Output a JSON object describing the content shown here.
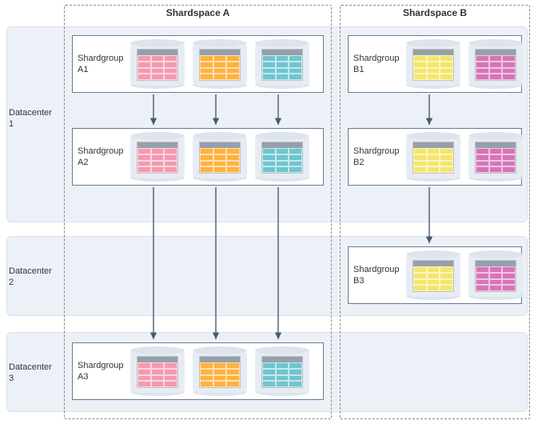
{
  "datacenters": [
    {
      "id": "dc1",
      "label": "Datacenter 1"
    },
    {
      "id": "dc2",
      "label": "Datacenter 2"
    },
    {
      "id": "dc3",
      "label": "Datacenter 3"
    }
  ],
  "shardspaces": [
    {
      "id": "ssA",
      "title": "Shardspace A",
      "groups": [
        {
          "id": "A1",
          "label": "Shardgroup A1",
          "shards": [
            "pink",
            "orange",
            "teal"
          ],
          "datacenter": "dc1"
        },
        {
          "id": "A2",
          "label": "Shardgroup A2",
          "shards": [
            "pink",
            "orange",
            "teal"
          ],
          "datacenter": "dc1"
        },
        {
          "id": "A3",
          "label": "Shardgroup A3",
          "shards": [
            "pink",
            "orange",
            "teal"
          ],
          "datacenter": "dc3"
        }
      ],
      "replication": [
        [
          "A1",
          "A2"
        ],
        [
          "A2",
          "A3"
        ]
      ]
    },
    {
      "id": "ssB",
      "title": "Shardspace B",
      "groups": [
        {
          "id": "B1",
          "label": "Shardgroup B1",
          "shards": [
            "yellow",
            "magenta"
          ],
          "datacenter": "dc1"
        },
        {
          "id": "B2",
          "label": "Shardgroup B2",
          "shards": [
            "yellow",
            "magenta"
          ],
          "datacenter": "dc1"
        },
        {
          "id": "B3",
          "label": "Shardgroup B3",
          "shards": [
            "yellow",
            "magenta"
          ],
          "datacenter": "dc2"
        }
      ],
      "replication": [
        [
          "B1",
          "B2"
        ],
        [
          "B2",
          "B3"
        ]
      ]
    }
  ]
}
